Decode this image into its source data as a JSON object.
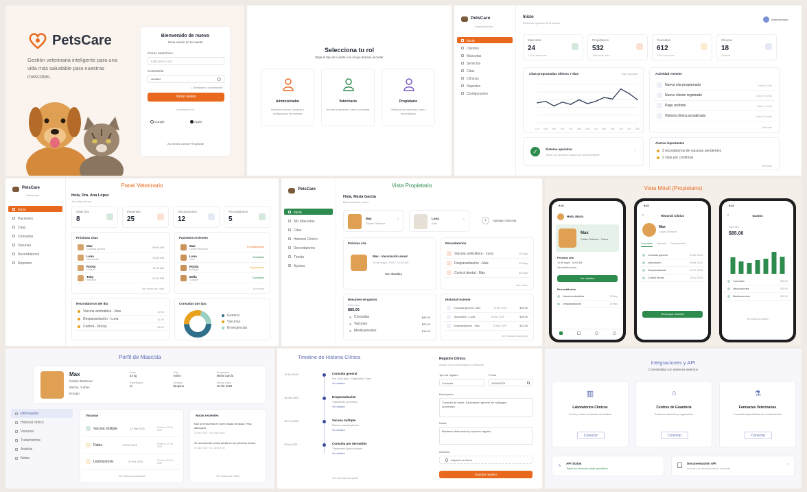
{
  "login": {
    "brand": "PetsCare",
    "tagline": "Gestión veterinaria inteligente para una vida más saludable para nuestras mascotas.",
    "form_title": "Bienvenido de nuevo",
    "form_subtitle": "Inicia sesión en tu cuenta",
    "email_label": "Correo electrónico",
    "email_placeholder": "tu@correo.com",
    "password_label": "Contraseña",
    "password_value": "••••••••",
    "forgot": "¿Olvidaste tu contraseña?",
    "submit": "Iniciar sesión",
    "or": "o continúa con",
    "google": "Google",
    "apple": "Apple",
    "register": "¿No tienes cuenta? Regístrate"
  },
  "roles": {
    "title": "Selecciona tu rol",
    "subtitle": "Elige el tipo de cuenta con el que deseas acceder",
    "items": [
      {
        "name": "Administrador",
        "desc": "Gestiona clínicas, usuarios y configuración del sistema",
        "color": "#e8691d"
      },
      {
        "name": "Veterinario",
        "desc": "Accede a pacientes, citas y consultas",
        "color": "#2e8b4e"
      },
      {
        "name": "Propietario",
        "desc": "Gestiona tus mascotas, citas y recordatorios",
        "color": "#7b5cc4"
      }
    ]
  },
  "admin": {
    "brand": "PetsCare",
    "brand_sub": "Administración",
    "header": "Inicio",
    "header_sub": "Resumen general de la clínica",
    "user": "Administrador",
    "nav": [
      "Inicio",
      "Clientes",
      "Mascotas",
      "Servicios",
      "Citas",
      "Clínicas",
      "Reportes",
      "Configuración"
    ],
    "stats": [
      {
        "label": "Mascotas",
        "value": "24",
        "sub": "+12% este mes",
        "color": "#2e8b4e"
      },
      {
        "label": "Propietarios",
        "value": "532",
        "sub": "+8% este mes",
        "color": "#e8691d"
      },
      {
        "label": "Consultas",
        "value": "612",
        "sub": "+5% este mes",
        "color": "#e8a11d"
      },
      {
        "label": "Clínicas",
        "value": "18",
        "sub": "Activas",
        "color": "#7b8fd4"
      }
    ],
    "chart_title": "Citas programadas últimos 7 días",
    "chart_filter": "Esta semana",
    "activity_title": "Actividad reciente",
    "activity": [
      {
        "text": "Nueva cita programada",
        "time": "Hace 5 min"
      },
      {
        "text": "Nuevo cliente registrado",
        "time": "Hace 15 min"
      },
      {
        "text": "Pago recibido",
        "time": "Hace 1 hora"
      },
      {
        "text": "Historia clínica actualizada",
        "time": "Hace 2 horas"
      }
    ],
    "activity_more": "Ver todo",
    "status_title": "Sistema operativo",
    "status_sub": "Todos los servicios funcionan correctamente",
    "alerts_title": "Alertas importantes",
    "alerts": [
      "3 recordatorios de vacunas pendientes",
      "2 citas por confirmar"
    ],
    "alerts_more": "Ver todo"
  },
  "chart_data": {
    "type": "line",
    "title": "Citas programadas últimos 7 días",
    "x": [
      "Lun",
      "Mar",
      "Mié",
      "Jue",
      "Vie",
      "Sáb",
      "Dom",
      "Lun",
      "Mar",
      "Mié",
      "Jue",
      "Vie",
      "Sáb"
    ],
    "series": [
      {
        "values": [
          26,
          28,
          22,
          27,
          24,
          30,
          25,
          28,
          33,
          31,
          44,
          38,
          30
        ]
      }
    ],
    "ylim": [
      0,
      50
    ],
    "color": "#2f3a57"
  },
  "vet": {
    "title": "Panel Veterinario",
    "brand": "PetsCare",
    "brand_sub": "Veterinario",
    "greeting": "Hola, Dra. Ana López",
    "greeting_sub": "Tus citas de hoy",
    "nav": [
      "Inicio",
      "Pacientes",
      "Citas",
      "Consultas",
      "Vacunas",
      "Recordatorios",
      "Reportes"
    ],
    "stats": [
      {
        "label": "Citas hoy",
        "value": "8",
        "color": "#2e8b4e"
      },
      {
        "label": "Pacientes",
        "value": "25",
        "color": "#e8691d"
      },
      {
        "label": "Vacunaciones",
        "value": "12",
        "color": "#7b8fd4"
      },
      {
        "label": "Recordatorios",
        "value": "5",
        "color": "#2e8b4e"
      }
    ],
    "appts_title": "Próximas citas",
    "appts": [
      {
        "name": "Max",
        "type": "Consulta general",
        "time": "09:00 AM"
      },
      {
        "name": "Luna",
        "type": "Vacunación",
        "time": "10:30 AM"
      },
      {
        "name": "Rocky",
        "type": "Control",
        "time": "11:30 AM"
      },
      {
        "name": "Toby",
        "type": "Revisión",
        "time": "12:30 PM"
      }
    ],
    "appts_more": "Ver todas las citas",
    "patients_title": "Pacientes recientes",
    "patients": [
      {
        "name": "Max",
        "type": "Golden Retriever",
        "status": "En tratamiento"
      },
      {
        "name": "Luna",
        "type": "Gato",
        "status": "Saludable"
      },
      {
        "name": "Rocky",
        "type": "Bulldog",
        "status": "Seguimiento"
      },
      {
        "name": "Bella",
        "type": "Caniche",
        "status": "Saludable"
      }
    ],
    "patients_more": "Ver todos",
    "reminders_title": "Recordatorios del día",
    "reminders": [
      {
        "text": "Vacuna antirrábica - Max",
        "time": "10:00"
      },
      {
        "text": "Desparasitación - Luna",
        "time": "11:30"
      },
      {
        "text": "Control - Rocky",
        "time": "16:00"
      }
    ],
    "donut_title": "Consultas por tipo",
    "donut_legend": [
      "General",
      "Vacunas",
      "Emergencias"
    ]
  },
  "owner": {
    "title": "Vista Propietario",
    "brand": "PetsCare",
    "greeting": "Hola, María García",
    "greeting_sub": "Bienvenida de nuevo",
    "nav": [
      "Inicio",
      "Mis Mascotas",
      "Citas",
      "Historial Clínico",
      "Recordatorios",
      "Tienda",
      "Ajustes"
    ],
    "pets": [
      {
        "name": "Max",
        "breed": "Golden Retriever"
      },
      {
        "name": "Luna",
        "breed": "Gato"
      }
    ],
    "add_pet": "Agregar mascota",
    "next_title": "Próxima cita",
    "next_pet": "Max - Vacunación anual",
    "next_date": "15 de mayo, 2025 · 10:00 AM",
    "next_btn": "Ver detalles",
    "rem_title": "Recordatorios",
    "rem": [
      {
        "text": "Vacuna antirrábica - Luna",
        "date": "20 May"
      },
      {
        "text": "Desparasitación - Max",
        "date": "25 May"
      },
      {
        "text": "Control dental - Max",
        "date": "30 May"
      }
    ],
    "rem_more": "Ver todos",
    "spend_title": "Resumen de gastos",
    "spend_period": "Este mes",
    "spend_total": "$85.00",
    "spend": [
      {
        "label": "Consultas",
        "value": "$45.00"
      },
      {
        "label": "Vacunas",
        "value": "$25.00"
      },
      {
        "label": "Medicamentos",
        "value": "$15.00"
      }
    ],
    "hist_title": "Historial reciente",
    "hist": [
      {
        "text": "Consulta general - Max",
        "date": "10 Abr 2025",
        "amount": "$45.00"
      },
      {
        "text": "Vacunación - Luna",
        "date": "28 Mar 2025",
        "amount": "$25.00"
      },
      {
        "text": "Desparasitación - Max",
        "date": "15 Mar 2025",
        "amount": "$15.00"
      }
    ],
    "hist_more": "Ver historial completo"
  },
  "mobile": {
    "title": "Vista Móvil (Propietario)",
    "time": "9:41",
    "s1": {
      "greeting": "Hola, María",
      "pet": "Max",
      "pet_sub": "Golden Retriever · 3 años",
      "next": "Próxima cita",
      "date": "15 de mayo · 10:00 AM",
      "type": "Vacunación anual",
      "btn": "Ver detalles",
      "rem": "Recordatorios",
      "items": [
        {
          "t": "Vacuna antirrábica",
          "d": "20 May"
        },
        {
          "t": "Desparasitación",
          "d": "25 May"
        }
      ]
    },
    "s2": {
      "title": "Historial Clínico",
      "pet": "Max",
      "pet_sub": "Golden Retriever",
      "tabs": [
        "Consultas",
        "Vacunas",
        "Documentos"
      ],
      "items": [
        {
          "t": "Consulta general",
          "d": "10 Abr 2025"
        },
        {
          "t": "Vacunación",
          "d": "15 Mar 2025"
        },
        {
          "t": "Desparasitación",
          "d": "10 Feb 2025"
        },
        {
          "t": "Control dental",
          "d": "5 Ene 2025"
        }
      ],
      "btn": "Descargar historial"
    },
    "s3": {
      "title": "Gastos",
      "period": "Este mes",
      "total": "$85.00",
      "bars": [
        60,
        45,
        40,
        50,
        55,
        80,
        62
      ],
      "items": [
        {
          "t": "Consultas",
          "v": "$45.00"
        },
        {
          "t": "Vacunaciones",
          "v": "$25.00"
        },
        {
          "t": "Medicamentos",
          "v": "$15.00"
        }
      ],
      "more": "Ver todos los gastos"
    }
  },
  "profile": {
    "title": "Perfil de Mascota",
    "name": "Max",
    "breed": "Golden Retriever",
    "sex": "Macho, 3 años",
    "color": "Dorado",
    "fields": [
      {
        "k": "Peso",
        "v": "32 kg"
      },
      {
        "k": "Chip",
        "v": "Activo"
      },
      {
        "k": "Propietario",
        "v": "María García"
      },
      {
        "k": "Esterilizado",
        "v": "Sí"
      },
      {
        "k": "Alergias",
        "v": "Ninguna"
      },
      {
        "k": "Última visita",
        "v": "10 Abr 2025"
      }
    ],
    "nav": [
      "Información",
      "Historial clínico",
      "Vacunas",
      "Tratamientos",
      "Análisis",
      "Notas"
    ],
    "vac_title": "Vacunas",
    "vac": [
      {
        "t": "Vacuna múltiple",
        "d": "12 Mar 2025",
        "s": "Próxima: 12 Mar 2026"
      },
      {
        "t": "Rabia",
        "d": "10 Feb 2025",
        "s": "Próxima: 10 Feb 2026"
      },
      {
        "t": "Leptospirosis",
        "d": "05 Ene 2025",
        "s": "Próxima: 05 Ene 2026"
      }
    ],
    "vac_more": "Ver todas las vacunas",
    "notes_title": "Notas recientes",
    "notes": [
      {
        "t": "Max se encuentra en buen estado de salud. Peso adecuado.",
        "d": "10 Abr 2025 · Dra. Ana López"
      },
      {
        "t": "Se recomienda control dental en los próximos meses.",
        "d": "15 Mar 2025 · Dr. Carlos Ruiz"
      }
    ],
    "notes_more": "Ver todas las notas"
  },
  "timeline": {
    "title": "Timeline de Historia Clínica",
    "events": [
      {
        "date": "10 Abr 2025",
        "t": "Consulta general",
        "s": "Dra. Ana López · Diagnóstico: Sano",
        "x": "Ver detalles"
      },
      {
        "date": "15 Mar 2025",
        "t": "Desparasitación",
        "s": "Tratamiento preventivo",
        "x": "Ver detalles"
      },
      {
        "date": "10 Feb 2025",
        "t": "Vacuna múltiple",
        "s": "Refuerzo anual aplicado",
        "x": "Ver detalles"
      },
      {
        "date": "5 Ene 2025",
        "t": "Consulta por dermatitis",
        "s": "Tratamiento tópico indicado",
        "x": "Ver detalles"
      }
    ],
    "more": "Ver historial completo",
    "form_title": "Registro Clínico",
    "form_sub": "Añade nueva información al historial",
    "f_type_label": "Tipo de registro",
    "f_type_value": "Consulta",
    "f_date_label": "Fecha",
    "f_date_value": "15/05/2025",
    "f_desc_label": "Descripción",
    "f_desc_value": "Consulta de rutina. Exploración general sin hallazgos anormales.",
    "f_notes_label": "Notas",
    "f_notes_value": "Mantener dieta actual y ejercicio regular.",
    "f_attach_label": "Archivos",
    "f_attach_value": "Adjuntar archivos",
    "f_submit": "Guardar registro"
  },
  "integrations": {
    "title": "Integraciones y API",
    "subtitle": "Conectividad con sistemas externos",
    "cards": [
      {
        "name": "Laboratorios Clínicos",
        "desc": "Envía y recibe resultados de análisis",
        "btn": "Conectar"
      },
      {
        "name": "Centros de Guardería",
        "desc": "Gestiona estancias y seguimiento",
        "btn": "Conectar"
      },
      {
        "name": "Farmacias Veterinarias",
        "desc": "Consulta disponibilidad de medicamentos",
        "btn": "Conectar"
      }
    ],
    "api_status": "API Status",
    "api_status_sub": "Todos los servicios están operativos",
    "api_docs": "Documentación API",
    "api_docs_sub": "Accede a la documentación completa"
  }
}
